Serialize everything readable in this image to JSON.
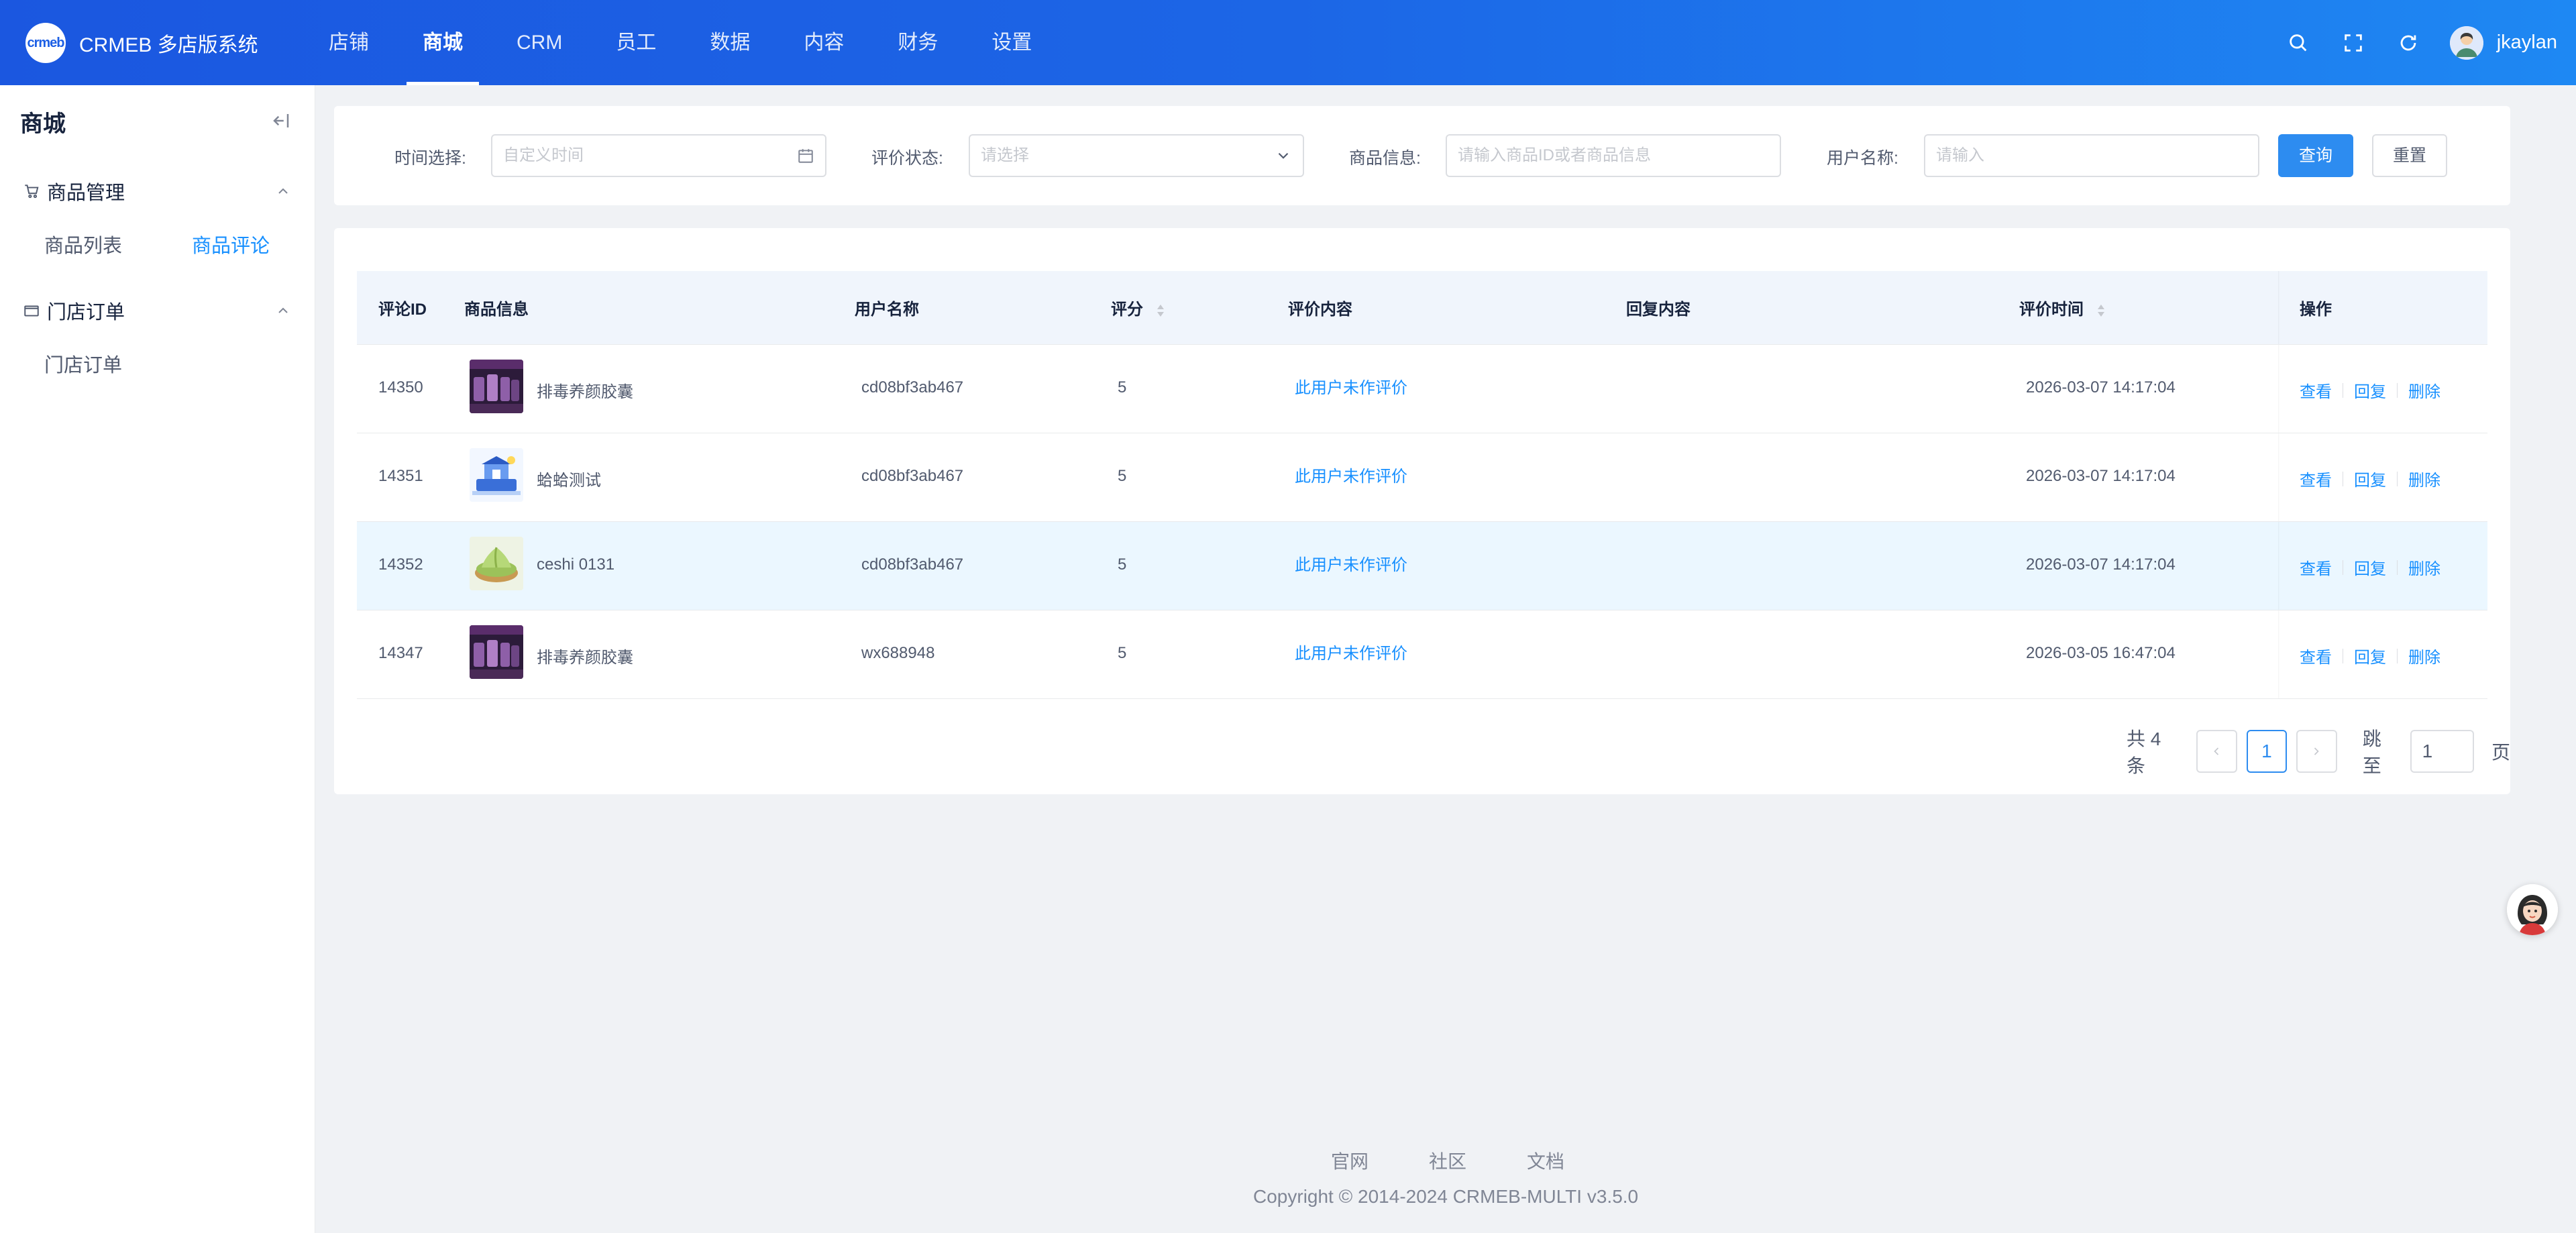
{
  "header": {
    "logo_mark": "crmeb",
    "app_title": "CRMEB 多店版系统",
    "nav": [
      {
        "label": "店铺",
        "active": false
      },
      {
        "label": "商城",
        "active": true
      },
      {
        "label": "CRM",
        "active": false
      },
      {
        "label": "员工",
        "active": false
      },
      {
        "label": "数据",
        "active": false
      },
      {
        "label": "内容",
        "active": false
      },
      {
        "label": "财务",
        "active": false
      },
      {
        "label": "设置",
        "active": false
      }
    ],
    "tools": [
      "search-icon",
      "fullscreen-icon",
      "refresh-icon"
    ],
    "user_name": "jkaylan"
  },
  "sidebar": {
    "title": "商城",
    "groups": [
      {
        "label": "商品管理",
        "icon": "cart-icon",
        "items": [
          "商品列表",
          "商品评论"
        ],
        "active_item": "商品评论"
      },
      {
        "label": "门店订单",
        "icon": "folder-icon",
        "items": [
          "门店订单"
        ]
      }
    ]
  },
  "filters": {
    "time_label": "时间选择:",
    "time_placeholder": "自定义时间",
    "status_label": "评价状态:",
    "status_placeholder": "请选择",
    "product_label": "商品信息:",
    "product_placeholder": "请输入商品ID或者商品信息",
    "user_label": "用户名称:",
    "user_placeholder": "请输入",
    "query_button": "查询",
    "reset_button": "重置"
  },
  "table": {
    "columns": [
      "评论ID",
      "商品信息",
      "用户名称",
      "评分",
      "评价内容",
      "回复内容",
      "评价时间",
      "操作"
    ],
    "rows": [
      {
        "id": "14350",
        "product": "排毒养颜胶囊",
        "user": "cd08bf3ab467",
        "score": "5",
        "comment": "此用户未作评价",
        "reply": "",
        "time": "2026-03-07 14:17:04"
      },
      {
        "id": "14351",
        "product": "蛤蛤测试",
        "user": "cd08bf3ab467",
        "score": "5",
        "comment": "此用户未作评价",
        "reply": "",
        "time": "2026-03-07 14:17:04"
      },
      {
        "id": "14352",
        "product": "ceshi 0131",
        "user": "cd08bf3ab467",
        "score": "5",
        "comment": "此用户未作评价",
        "reply": "",
        "time": "2026-03-07 14:17:04"
      },
      {
        "id": "14347",
        "product": "排毒养颜胶囊",
        "user": "wx688948",
        "score": "5",
        "comment": "此用户未作评价",
        "reply": "",
        "time": "2026-03-05 16:47:04"
      }
    ],
    "actions": [
      "查看",
      "回复",
      "删除"
    ]
  },
  "pagination": {
    "total_text": "共 4 条",
    "current_page": "1",
    "jump_label": "跳至",
    "jump_value": "1",
    "page_suffix": "页"
  },
  "footer": {
    "links": [
      "官网",
      "社区",
      "文档"
    ],
    "copyright": "Copyright © 2014-2024 CRMEB-MULTI v3.5.0"
  },
  "colors": {
    "header_start": "#1b57e0",
    "header_end": "#1e88f3",
    "primary": "#2d8cf0",
    "link": "#1890ff"
  }
}
